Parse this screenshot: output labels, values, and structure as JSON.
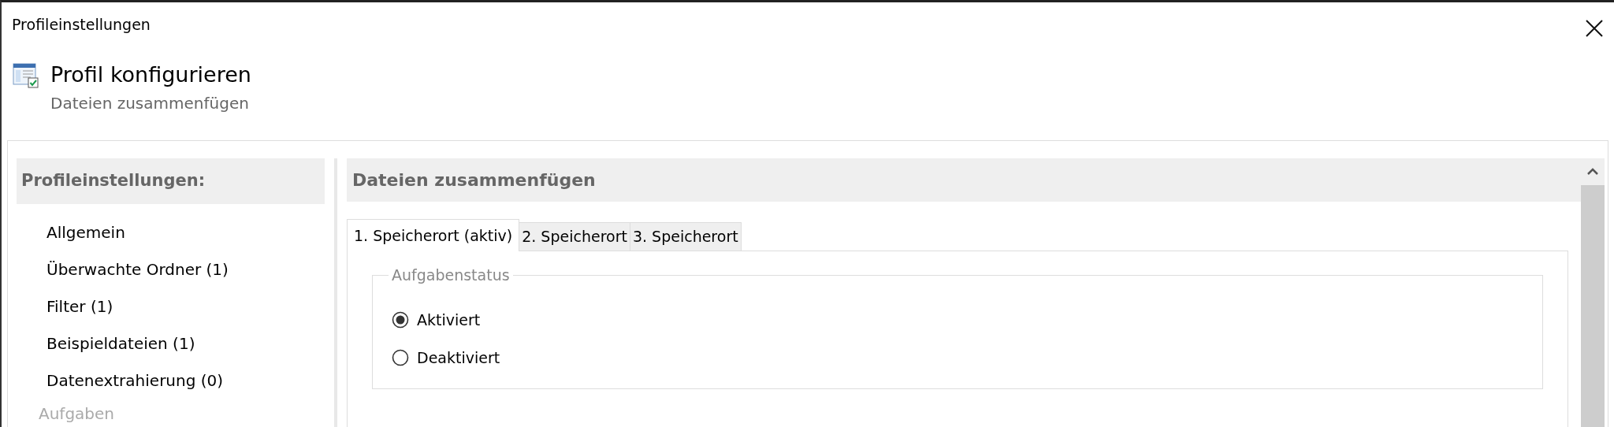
{
  "window": {
    "title": "Profileinstellungen"
  },
  "header": {
    "title": "Profil konfigurieren",
    "subtitle": "Dateien zusammenfügen"
  },
  "sidebar": {
    "heading": "Profileinstellungen:",
    "items": [
      {
        "label": "Allgemein"
      },
      {
        "label": "Überwachte Ordner (1)"
      },
      {
        "label": "Filter (1)"
      },
      {
        "label": "Beispieldateien (1)"
      },
      {
        "label": "Datenextrahierung (0)"
      }
    ],
    "section_label": "Aufgaben"
  },
  "main": {
    "heading": "Dateien zusammenfügen",
    "tabs": [
      {
        "label": "1. Speicherort (aktiv)",
        "selected": true
      },
      {
        "label": "2. Speicherort",
        "selected": false
      },
      {
        "label": "3. Speicherort",
        "selected": false
      }
    ],
    "group": {
      "legend": "Aufgabenstatus",
      "options": [
        {
          "label": "Aktiviert",
          "selected": true
        },
        {
          "label": "Deaktiviert",
          "selected": false
        }
      ]
    }
  }
}
